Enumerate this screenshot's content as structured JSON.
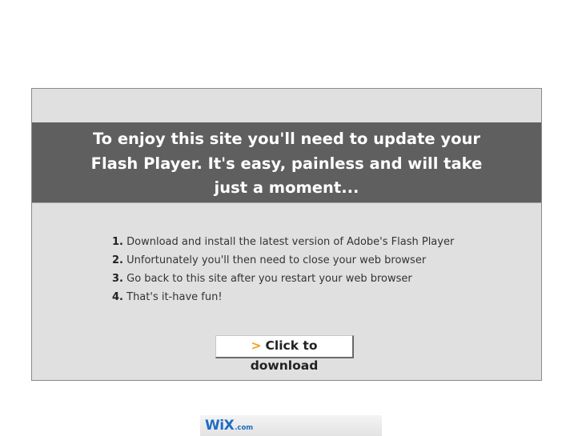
{
  "banner": {
    "message": "To enjoy this site you'll need to update your Flash Player. It's easy, painless and will take just a moment..."
  },
  "steps": [
    {
      "number": "1.",
      "text": "Download and install the latest version of Adobe's Flash Player"
    },
    {
      "number": "2.",
      "text": "Unfortunately you'll then need to close your web browser"
    },
    {
      "number": "3.",
      "text": "Go back to this site after you restart your web browser"
    },
    {
      "number": "4.",
      "text": "That's it-have fun!"
    }
  ],
  "download_button": {
    "arrow": ">",
    "label": "Click to download"
  },
  "footer": {
    "wix_logo": "WiX",
    "wix_dotcom": ".com"
  },
  "colors": {
    "banner_bg": "#5f5f5f",
    "panel_bg": "#e0e0e0",
    "accent_arrow": "#f39c12",
    "wix_blue": "#1e6dc5"
  }
}
